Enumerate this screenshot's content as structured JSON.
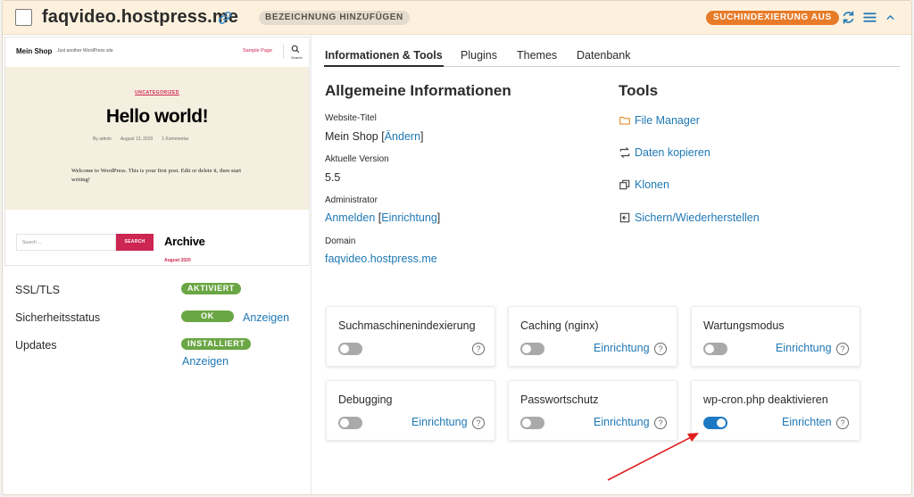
{
  "header": {
    "site_name": "faqvideo.hostpress.me",
    "add_label": "BEZEICHNUNG HINZUFÜGEN",
    "index_status": "SUCHINDEXIERUNG AUS",
    "accent": "#e77b28"
  },
  "preview": {
    "brand": "Mein Shop",
    "tagline": "Just another WordPress site",
    "nav_link": "Sample Page",
    "search_caption": "Search",
    "category": "UNCATEGORIZED",
    "post_title": "Hello world!",
    "meta_author": "By admin",
    "meta_date": "August 13, 2020",
    "meta_comments": "1 Kommentar",
    "excerpt": "Welcome to WordPress. This is your first post. Edit or delete it, then start writing!",
    "search_placeholder": "Search ...",
    "search_button": "SEARCH",
    "archive_title": "Archive",
    "archive_item": "August 2020"
  },
  "status": {
    "ssl_label": "SSL/TLS",
    "ssl_value": "AKTIVIERT",
    "security_label": "Sicherheitsstatus",
    "security_value": "OK",
    "security_link": "Anzeigen",
    "updates_label": "Updates",
    "updates_value": "INSTALLIERT",
    "updates_link": "Anzeigen"
  },
  "tabs": [
    "Informationen & Tools",
    "Plugins",
    "Themes",
    "Datenbank"
  ],
  "info": {
    "title": "Allgemeine Informationen",
    "site_title_label": "Website-Titel",
    "site_title_value": "Mein Shop",
    "site_title_link": "Ändern",
    "version_label": "Aktuelle Version",
    "version_value": "5.5",
    "admin_label": "Administrator",
    "admin_login": "Anmelden",
    "admin_setup": "Einrichtung",
    "domain_label": "Domain",
    "domain_value": "faqvideo.hostpress.me"
  },
  "tools": {
    "title": "Tools",
    "items": [
      "File Manager",
      "Daten kopieren",
      "Klonen",
      "Sichern/Wiederherstellen"
    ]
  },
  "cards": [
    {
      "title": "Suchmaschinenindexierung",
      "link": "",
      "on": false
    },
    {
      "title": "Caching (nginx)",
      "link": "Einrichtung",
      "on": false
    },
    {
      "title": "Wartungsmodus",
      "link": "Einrichtung",
      "on": false
    },
    {
      "title": "Debugging",
      "link": "Einrichtung",
      "on": false
    },
    {
      "title": "Passwortschutz",
      "link": "Einrichtung",
      "on": false
    },
    {
      "title": "wp-cron.php deaktivieren",
      "link": "Einrichten",
      "on": true
    }
  ]
}
